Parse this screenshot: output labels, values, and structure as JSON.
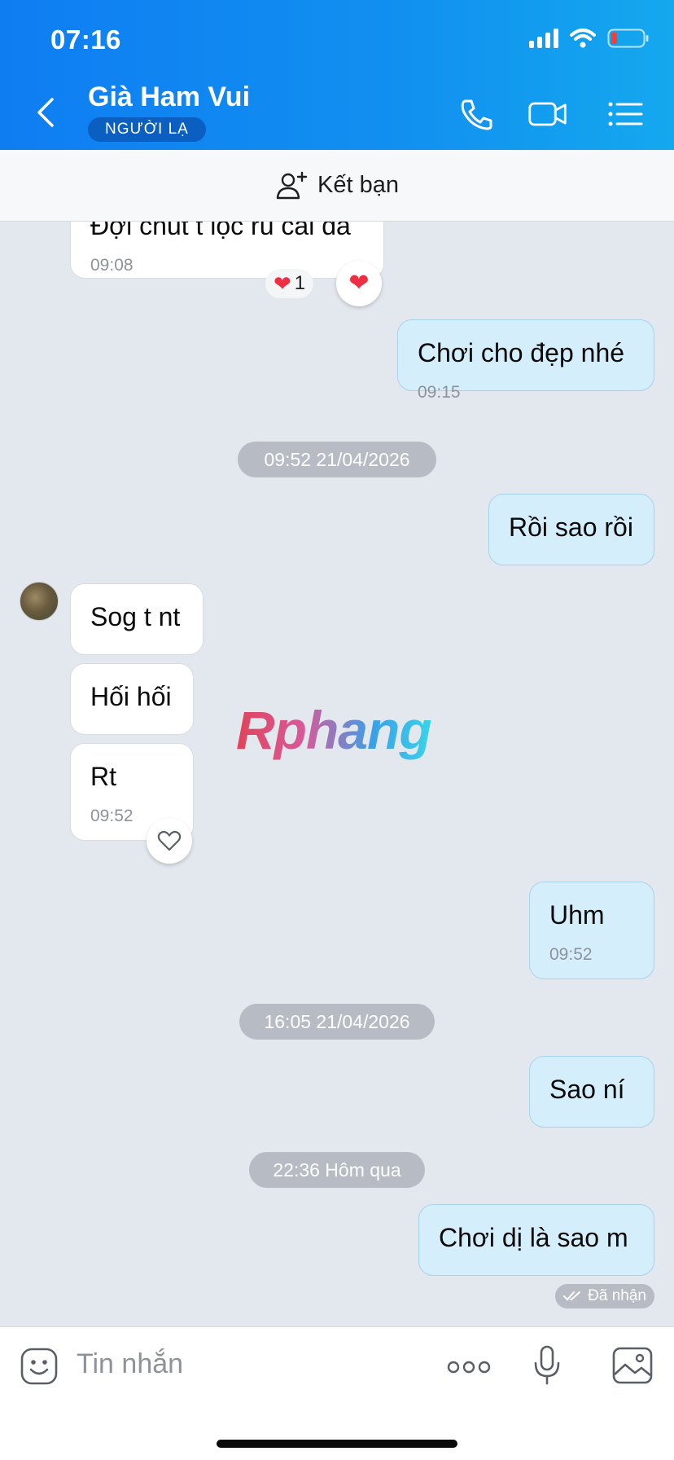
{
  "status_bar": {
    "time": "07:16"
  },
  "header": {
    "title": "Già Ham Vui",
    "badge": "NGƯỜI LẠ",
    "icons": [
      "back-icon",
      "phone-icon",
      "video-icon",
      "list-icon"
    ]
  },
  "add_friend": {
    "label": "Kết bạn"
  },
  "messages": [
    {
      "dir": "in",
      "text": "Đợi chút t lộc rủ cái đã",
      "time": "09:08",
      "reaction": "❤",
      "reaction_count": "1"
    },
    {
      "dir": "out",
      "text": "Chơi cho đẹp nhé",
      "time": "09:15"
    },
    {
      "date": "09:52 21/04/2026"
    },
    {
      "dir": "out",
      "text": "Rồi sao rồi"
    },
    {
      "dir": "in",
      "text": "Sog t nt"
    },
    {
      "dir": "in",
      "text": "Hối hối"
    },
    {
      "dir": "in",
      "text": "Rt",
      "time": "09:52"
    },
    {
      "dir": "out",
      "text": "Uhm",
      "time": "09:52"
    },
    {
      "date": "16:05 21/04/2026"
    },
    {
      "dir": "out",
      "text": "Sao ní"
    },
    {
      "date": "22:36 Hôm qua"
    },
    {
      "dir": "out",
      "text": "Chơi dị là sao m",
      "status": "Đã nhận"
    }
  ],
  "watermark": "Rphang",
  "input": {
    "placeholder": "Tin nhắn"
  },
  "colors": {
    "header_start": "#0f7df2",
    "header_end": "#14a8ee",
    "outgoing_bubble": "#d5eefc",
    "chat_bg": "#e3e7ee"
  }
}
